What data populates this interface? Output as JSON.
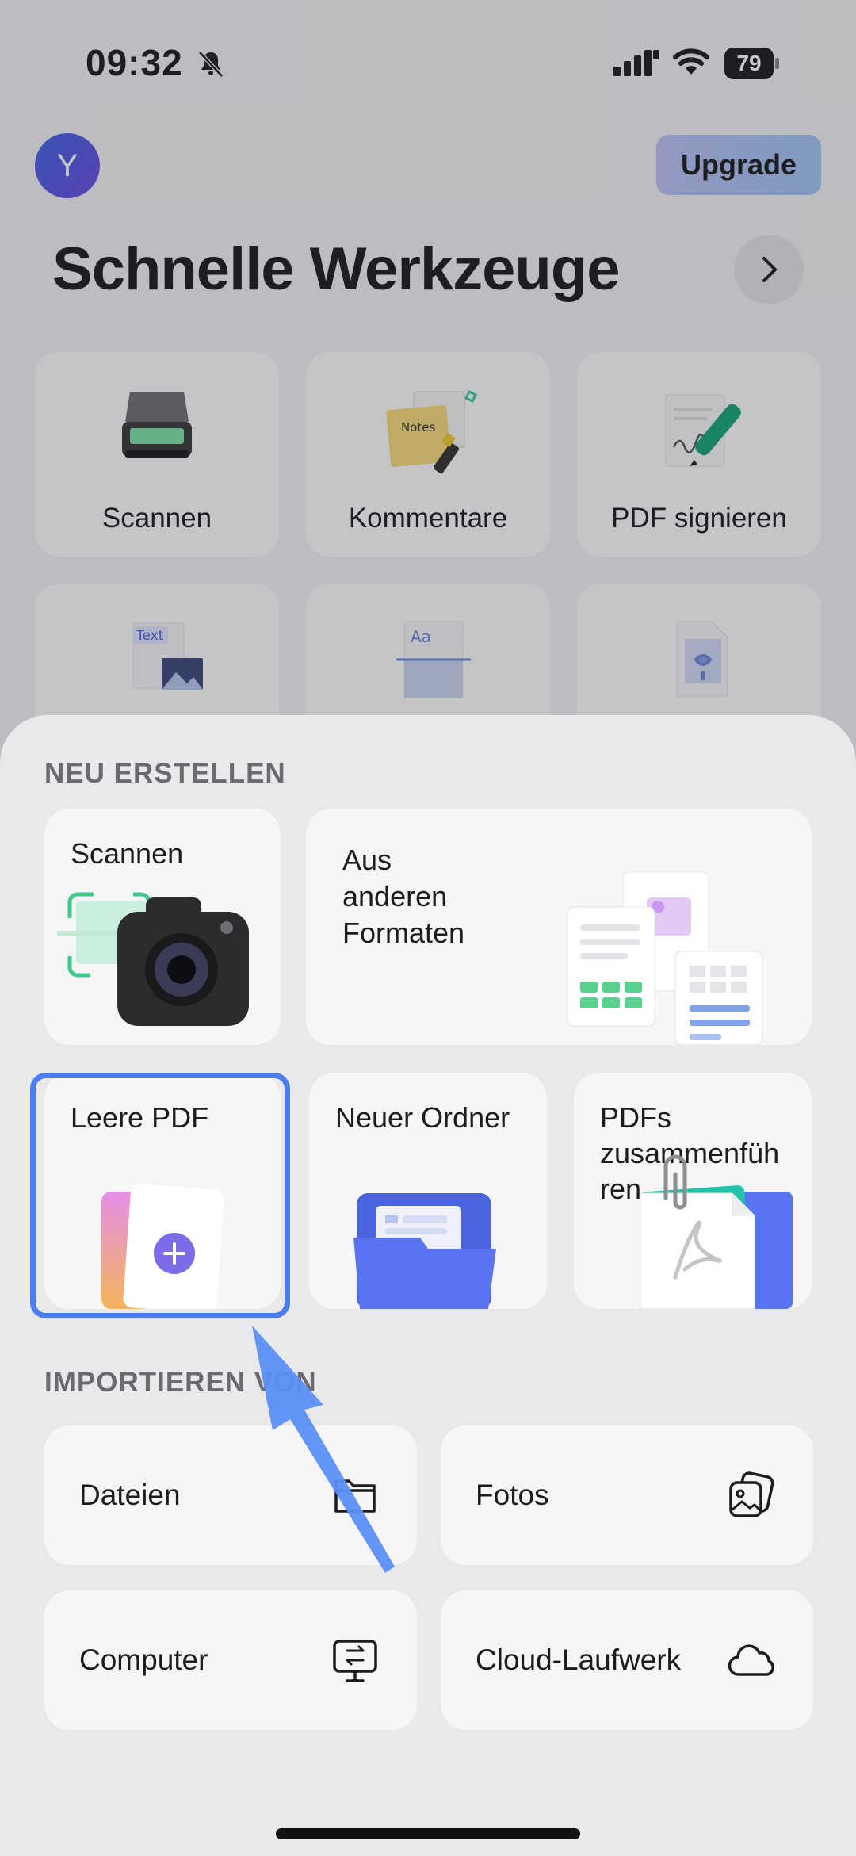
{
  "status_bar": {
    "time": "09:32",
    "battery": "79",
    "icons": [
      "bell-slash-icon",
      "cellular-signal-icon",
      "wifi-icon",
      "battery-icon"
    ]
  },
  "header": {
    "avatar_letter": "Y",
    "upgrade_label": "Upgrade",
    "title": "Schnelle Werkzeuge"
  },
  "quick_tools": [
    {
      "label": "Scannen",
      "icon": "scanner-icon"
    },
    {
      "label": "Kommentare",
      "icon": "notes-icon"
    },
    {
      "label": "PDF signieren",
      "icon": "signature-pen-icon"
    },
    {
      "label": "",
      "icon": "text-image-icon"
    },
    {
      "label": "",
      "icon": "font-document-icon"
    },
    {
      "label": "",
      "icon": "image-document-icon"
    }
  ],
  "sheet": {
    "create_heading": "NEU ERSTELLEN",
    "create": {
      "scan": "Scannen",
      "formats": [
        "Aus",
        "anderen",
        "Formaten"
      ],
      "blank": "Leere PDF",
      "folder": "Neuer Ordner",
      "merge": [
        "PDFs",
        "zusammenfüh",
        "ren"
      ]
    },
    "import_heading": "IMPORTIEREN VON",
    "import": [
      {
        "label": "Dateien",
        "icon": "folder-icon"
      },
      {
        "label": "Fotos",
        "icon": "photos-icon"
      },
      {
        "label": "Computer",
        "icon": "computer-transfer-icon"
      },
      {
        "label": "Cloud-Laufwerk",
        "icon": "cloud-icon"
      }
    ]
  },
  "colors": {
    "accent": "#4a7cf3",
    "selection": "#4a7cf3",
    "sheet_bg": "#e9e9eb"
  }
}
